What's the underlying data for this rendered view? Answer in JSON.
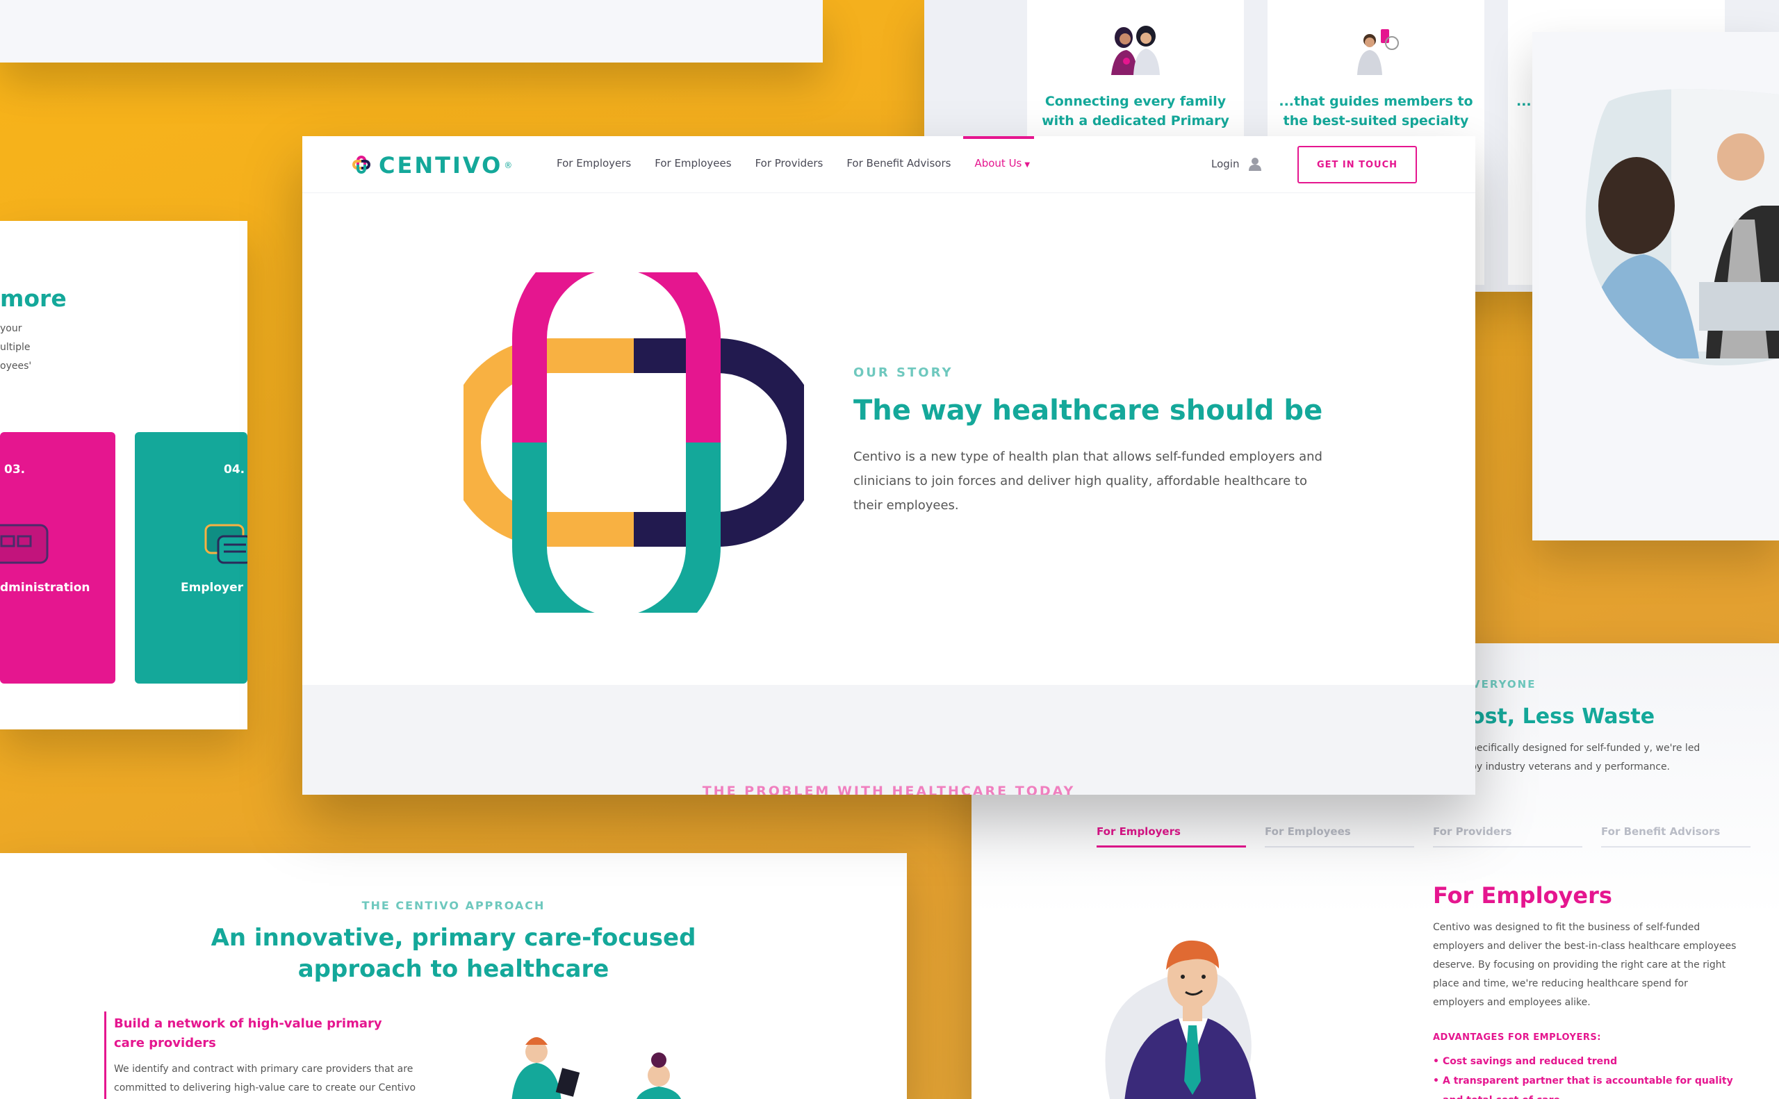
{
  "colors": {
    "teal": "#14a89a",
    "pink": "#e5168f",
    "navy": "#221a4f",
    "orange": "#f8b142",
    "background": "#f0ab22"
  },
  "main": {
    "brand": "CENTIVO",
    "brand_mark": "®",
    "nav": [
      "For Employers",
      "For Employees",
      "For Providers",
      "For Benefit Advisors",
      "About Us"
    ],
    "active_nav": "About Us",
    "login_label": "Login",
    "cta_label": "GET IN TOUCH",
    "hero": {
      "eyebrow": "OUR STORY",
      "title": "The way healthcare should be",
      "body": "Centivo is a new type of health plan that allows self-funded employers and clinicians to join forces and deliver high quality, affordable healthcare to their employees."
    },
    "next_section_eyebrow": "THE PROBLEM WITH HEALTHCARE TODAY"
  },
  "features": {
    "items": [
      {
        "text": "Connecting every family with a dedicated Primary",
        "icon": "two-women-icon"
      },
      {
        "text": "...that guides members to the best-suited specialty",
        "icon": "doctor-phone-icon"
      },
      {
        "text": "..."
      }
    ]
  },
  "process": {
    "heading": "more",
    "desc_lines": [
      "your",
      "ultiple",
      "oyees'"
    ],
    "steps": [
      {
        "num": "03.",
        "label": "dministration",
        "color": "#e5168f"
      },
      {
        "num": "04.",
        "label": "Employer S",
        "color": "#14a89a"
      }
    ]
  },
  "approach": {
    "eyebrow": "THE CENTIVO APPROACH",
    "title": "An innovative, primary care-focused approach to healthcare",
    "item_title": "Build a network of high-value primary care providers",
    "item_body": "We identify and contract with primary care providers that are committed to delivering high-value care to create our Centivo"
  },
  "employers": {
    "eyebrow": "VERYONE",
    "heading": "ost, Less Waste",
    "desc": "pecifically designed for self-funded y, we're led by industry veterans and y performance.",
    "tabs": [
      "For Employers",
      "For Employees",
      "For Providers",
      "For Benefit Advisors"
    ],
    "active_tab": "For Employers",
    "title": "For Employers",
    "body": "Centivo was designed to fit the business of self-funded employers and deliver the best-in-class healthcare employees deserve. By focusing on providing the right care at the right place and time, we're reducing healthcare spend for employers and employees alike.",
    "adv_title": "ADVANTAGES FOR EMPLOYERS:",
    "advantages": [
      "Cost savings and reduced trend",
      "A transparent partner that is accountable for quality and total cost of care"
    ]
  }
}
